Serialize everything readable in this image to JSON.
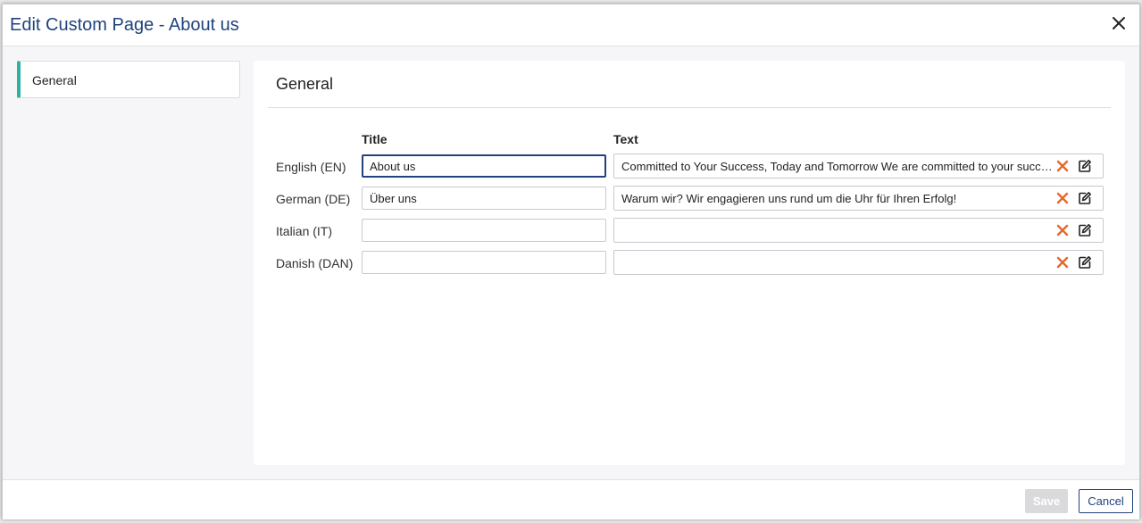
{
  "dialog": {
    "title": "Edit Custom Page - About us"
  },
  "sidebar": {
    "items": [
      {
        "label": "General",
        "active": true
      }
    ]
  },
  "section": {
    "title": "General",
    "columns": {
      "title": "Title",
      "text": "Text"
    }
  },
  "languages": [
    {
      "label": "English (EN)",
      "title": "About us",
      "text": "Committed to Your Success, Today and Tomorrow We are committed to your success"
    },
    {
      "label": "German (DE)",
      "title": "Über uns",
      "text": "Warum wir? Wir engagieren uns rund um die Uhr für Ihren Erfolg!"
    },
    {
      "label": "Italian (IT)",
      "title": "",
      "text": ""
    },
    {
      "label": "Danish (DAN)",
      "title": "",
      "text": ""
    }
  ],
  "footer": {
    "save_label": "Save",
    "cancel_label": "Cancel"
  },
  "colors": {
    "accent": "#2bb3a6",
    "title_blue": "#20437e",
    "clear_orange": "#e8672a"
  },
  "icons": {
    "close": "close-icon",
    "clear": "clear-x-icon",
    "edit": "edit-icon"
  }
}
